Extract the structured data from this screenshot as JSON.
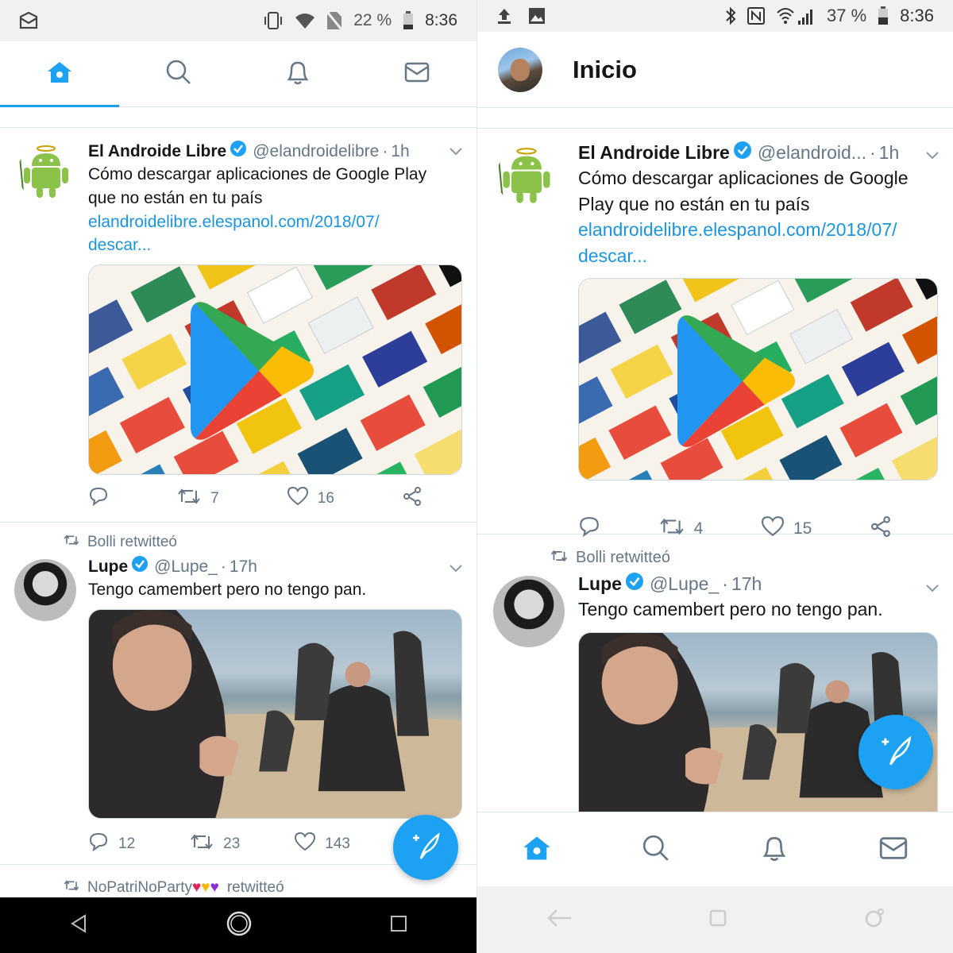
{
  "colors": {
    "accent": "#1da1f2",
    "link": "#1b95e0",
    "secondary_text": "#657786",
    "heart": "#e0245e",
    "gold_heart": "#f5b800",
    "purple_heart": "#8b2bd8"
  },
  "left": {
    "status": {
      "battery": "22 %",
      "time": "8:36"
    },
    "tabs": [
      {
        "icon": "home-icon"
      },
      {
        "icon": "search-icon"
      },
      {
        "icon": "bell-icon"
      },
      {
        "icon": "mail-icon"
      }
    ],
    "tweet1": {
      "name": "El Androide Libre",
      "handle": "@elandroidelibre",
      "time": "1h",
      "text_line1": "Cómo descargar aplicaciones de Google Play",
      "text_line2": "que no están en tu país",
      "link_line1": "elandroidelibre.elespanol.com/2018/07/",
      "link_line2": "descar...",
      "retweets": "7",
      "likes": "16"
    },
    "tweet2": {
      "retweeted_by": "Bolli retwitteó",
      "name": "Lupe",
      "handle": "@Lupe_",
      "time": "17h",
      "text": "Tengo camembert pero no tengo pan.",
      "replies": "12",
      "retweets": "23",
      "likes": "143"
    },
    "next_banner": {
      "user": "NoPatriNoParty",
      "suffix": "retwitteó"
    }
  },
  "right": {
    "status": {
      "battery": "37 %",
      "time": "8:36"
    },
    "header": {
      "title": "Inicio"
    },
    "tweet1": {
      "name": "El Androide Libre",
      "handle": "@elandroid...",
      "time": "1h",
      "text_line1": "Cómo descargar aplicaciones de Google",
      "text_line2": "Play que no están en tu país",
      "link_line1": "elandroidelibre.elespanol.com/2018/07/",
      "link_line2": "descar...",
      "retweets": "4",
      "likes": "15"
    },
    "tweet2": {
      "retweeted_by": "Bolli retwitteó",
      "name": "Lupe",
      "handle": "@Lupe_",
      "time": "17h",
      "text": "Tengo camembert pero no tengo pan."
    },
    "bottom_tabs": [
      {
        "icon": "home-icon"
      },
      {
        "icon": "search-icon"
      },
      {
        "icon": "bell-icon"
      },
      {
        "icon": "mail-icon"
      }
    ]
  }
}
